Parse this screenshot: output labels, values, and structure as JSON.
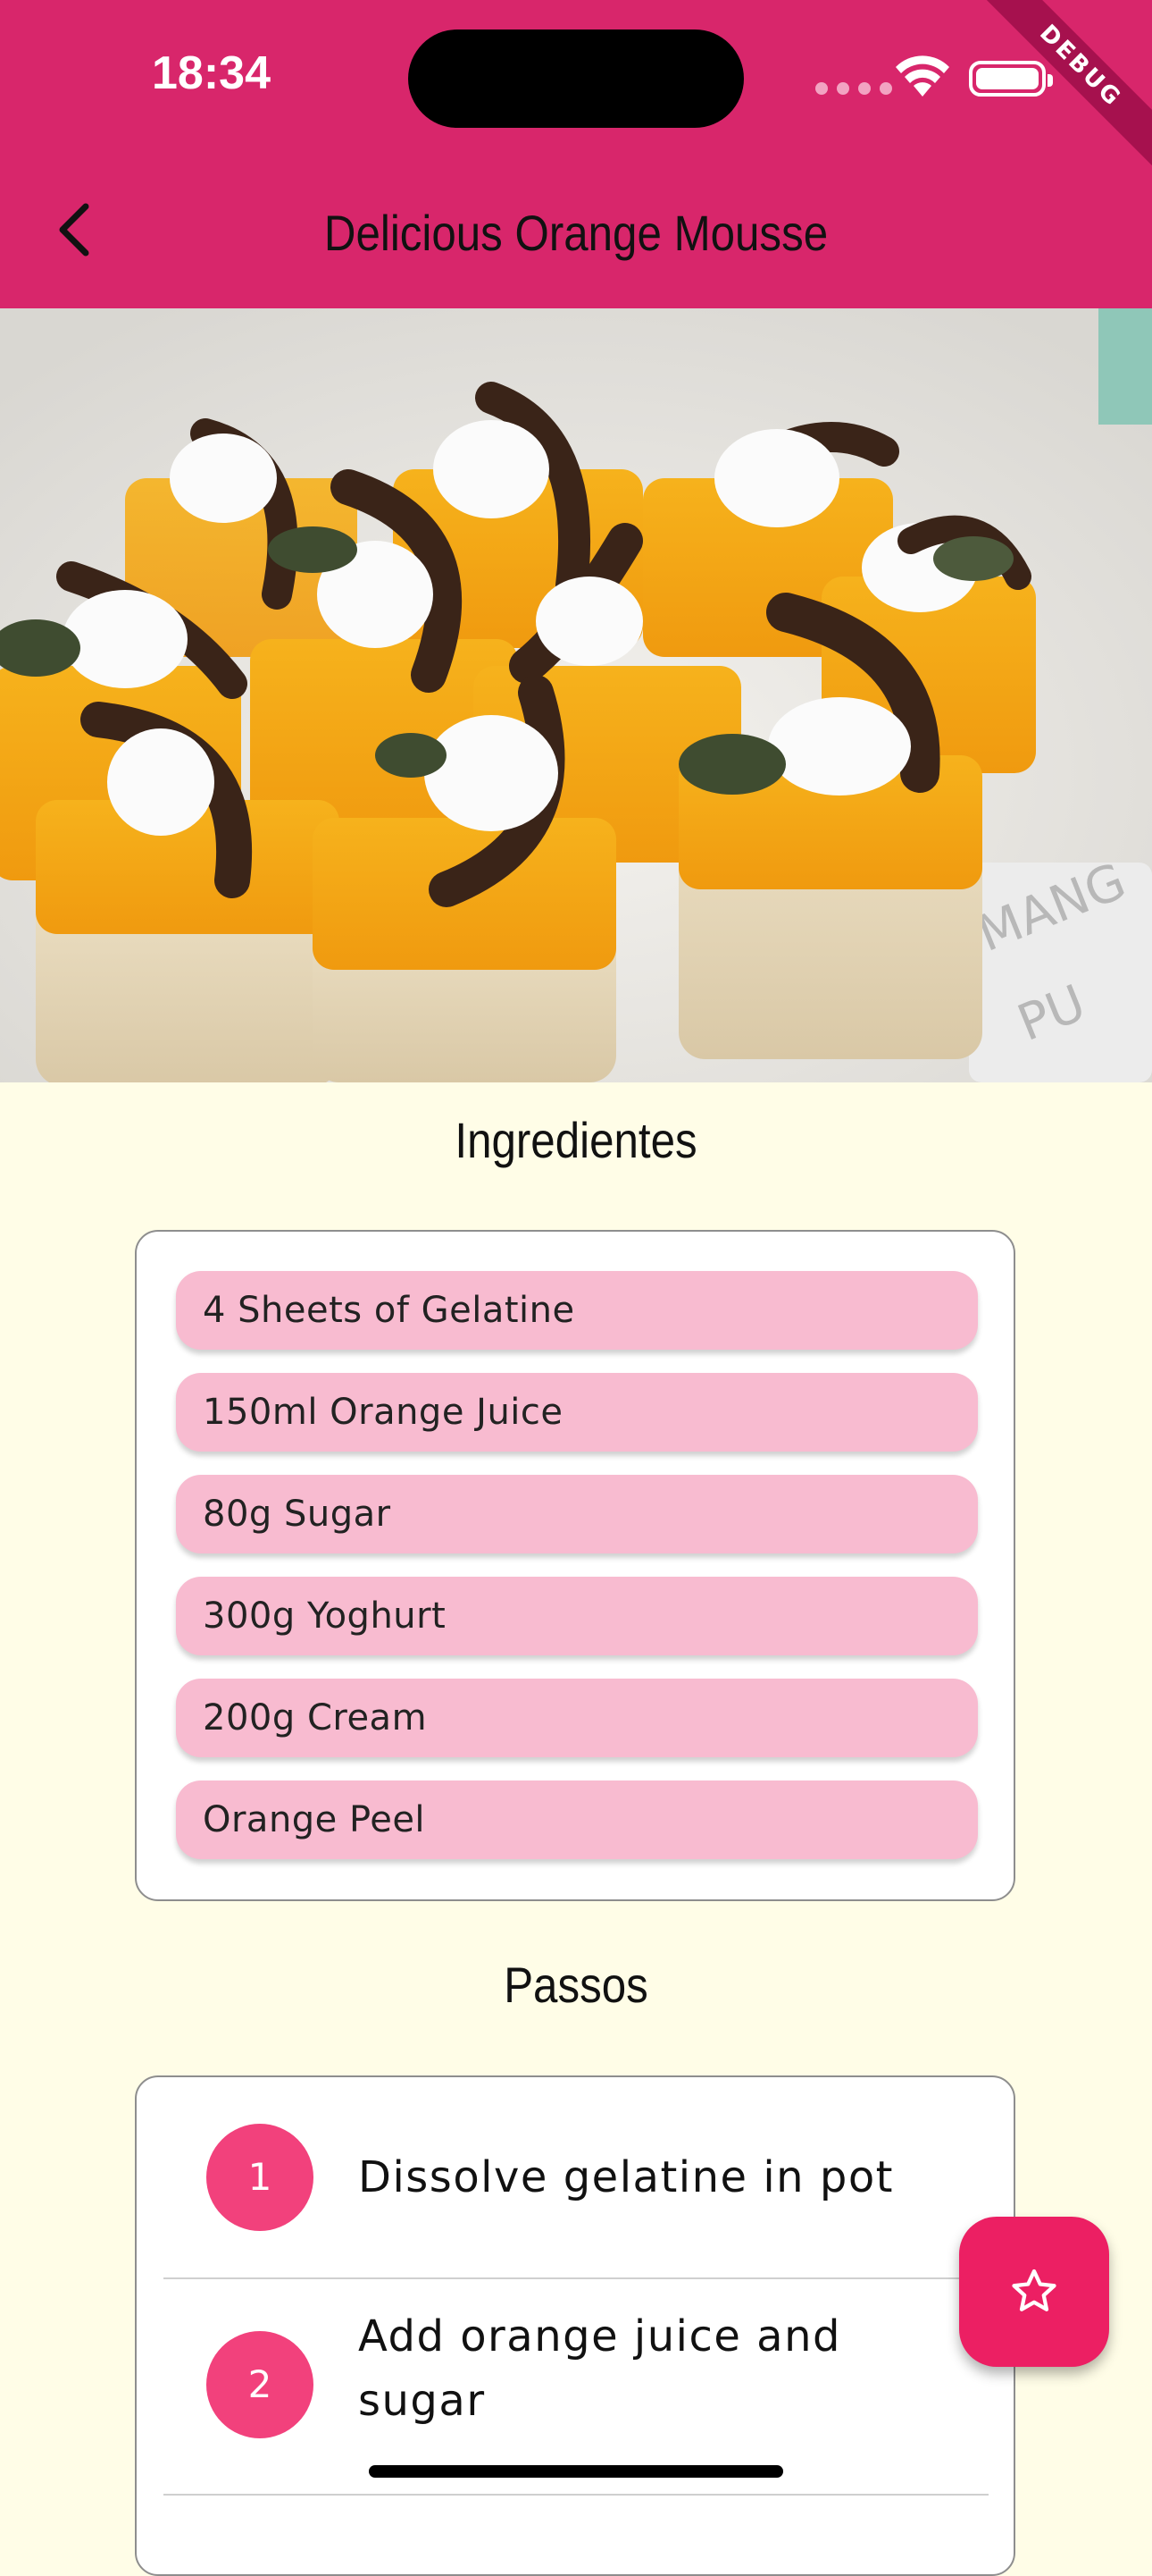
{
  "status_bar": {
    "time": "18:34"
  },
  "debug_banner": "DEBUG",
  "app_bar": {
    "title": "Delicious Orange Mousse",
    "back_icon": "chevron-left-icon"
  },
  "hero": {
    "image_alt": ""
  },
  "ingredients": {
    "heading": "Ingredientes",
    "items": [
      "4 Sheets of Gelatine",
      "150ml Orange Juice",
      "80g Sugar",
      "300g Yoghurt",
      "200g Cream",
      "Orange Peel"
    ]
  },
  "steps": {
    "heading": "Passos",
    "items": [
      {
        "number": "1",
        "text": "Dissolve gelatine in pot"
      },
      {
        "number": "2",
        "text": "Add orange juice and sugar"
      }
    ]
  },
  "fab": {
    "icon": "star-outline-icon"
  },
  "colors": {
    "primary": "#d8266b",
    "background": "#fffde7",
    "chip": "#f8bbd0",
    "accent": "#ec1f63"
  }
}
